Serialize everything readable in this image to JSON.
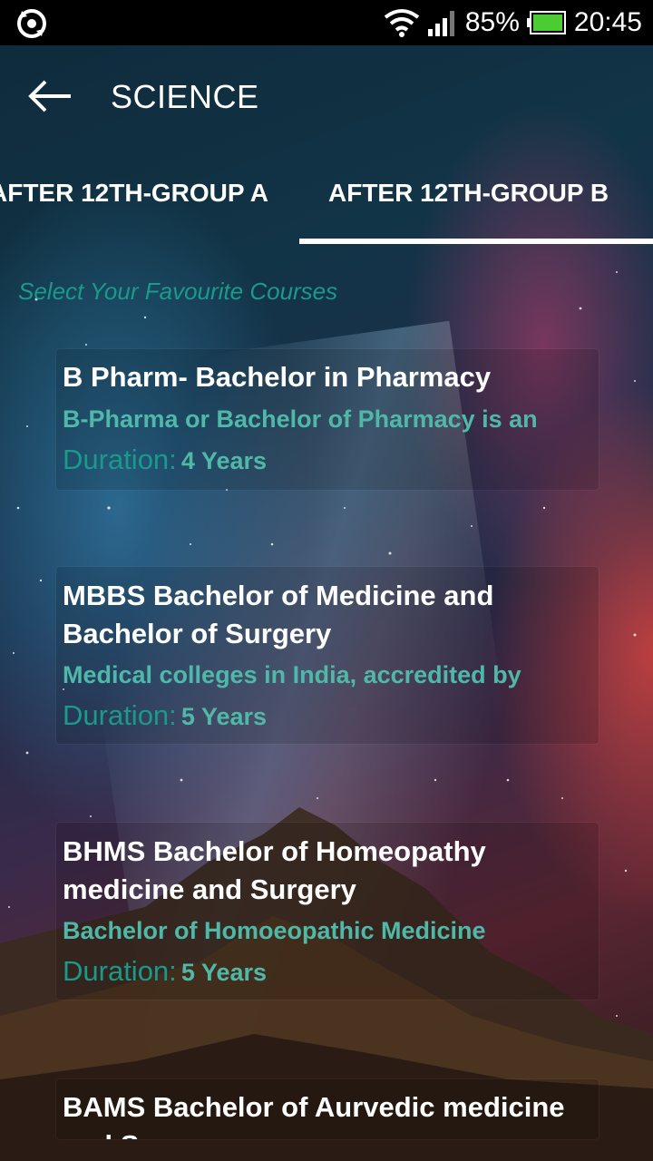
{
  "status_bar": {
    "battery": "85%",
    "time": "20:45"
  },
  "toolbar": {
    "title": "SCIENCE"
  },
  "tabs": [
    {
      "label": "AFTER 12TH-GROUP A",
      "selected": false
    },
    {
      "label": "AFTER 12TH-GROUP B",
      "selected": true
    }
  ],
  "section_heading": "Select Your Favourite Courses",
  "duration_label": "Duration:",
  "courses": [
    {
      "title": "B Pharm- Bachelor in Pharmacy",
      "description": "B-Pharma or Bachelor of Pharmacy is an",
      "duration": "4 Years"
    },
    {
      "title": "MBBS Bachelor of Medicine and Bachelor of Surgery",
      "description": "Medical colleges in India, accredited by",
      "duration": "5 Years"
    },
    {
      "title": "BHMS Bachelor of Homeopathy medicine and Surgery",
      "description": "Bachelor of Homoeopathic Medicine",
      "duration": "5 Years"
    },
    {
      "title": "BAMS Bachelor of Aurvedic medicine and Surgery"
    }
  ],
  "colors": {
    "accent": "#1a9a8a",
    "description": "#4fb8a8",
    "battery": "#4ccc33"
  }
}
